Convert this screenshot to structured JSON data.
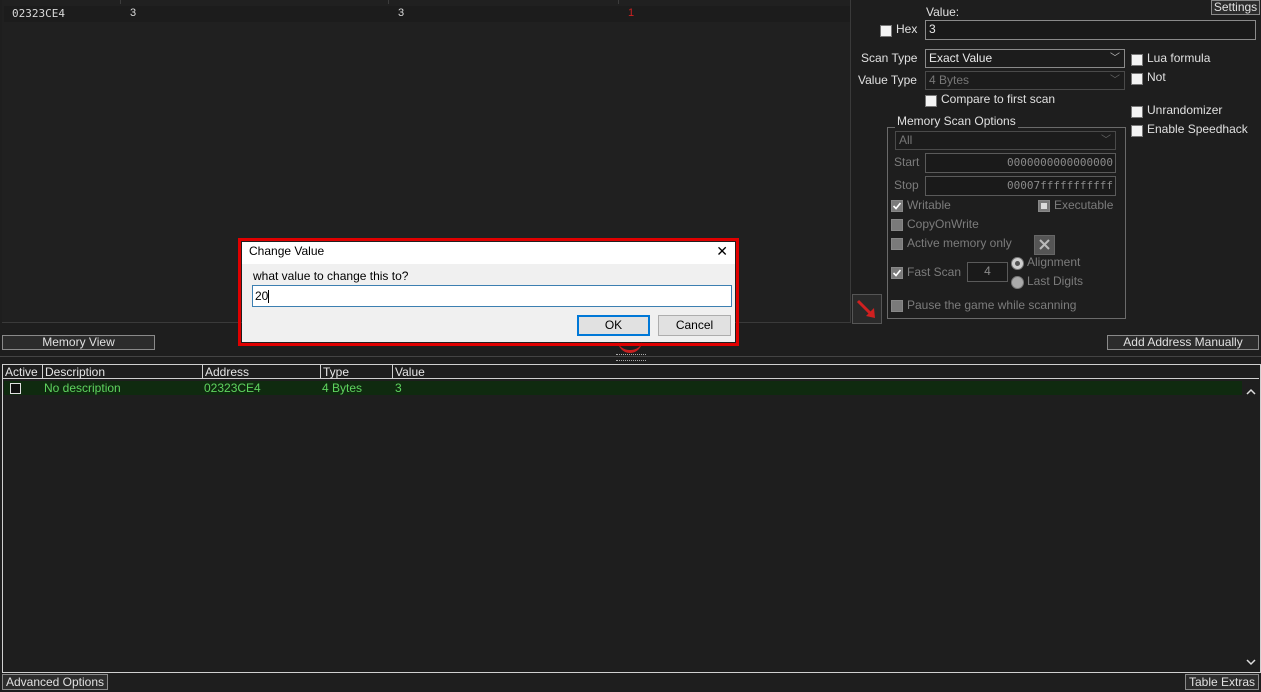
{
  "results": {
    "row": {
      "address": "02323CE4",
      "value": "3",
      "previous": "3",
      "first": "1"
    }
  },
  "scan": {
    "settings_label": "Settings",
    "value_label": "Value:",
    "hex_label": "Hex",
    "value_input": "3",
    "scan_type_label": "Scan Type",
    "scan_type_value": "Exact Value",
    "value_type_label": "Value Type",
    "value_type_value": "4 Bytes",
    "lua_formula_label": "Lua formula",
    "not_label": "Not",
    "compare_first_label": "Compare to first scan",
    "unrandomizer_label": "Unrandomizer",
    "speedhack_label": "Enable Speedhack"
  },
  "memory_options": {
    "title": "Memory Scan Options",
    "region_value": "All",
    "start_label": "Start",
    "start_value": "0000000000000000",
    "stop_label": "Stop",
    "stop_value": "00007fffffffffff",
    "writable_label": "Writable",
    "executable_label": "Executable",
    "copyonwrite_label": "CopyOnWrite",
    "active_memory_label": "Active memory only",
    "fast_scan_label": "Fast Scan",
    "fast_scan_value": "4",
    "alignment_label": "Alignment",
    "last_digits_label": "Last Digits",
    "pause_label": "Pause the game while scanning"
  },
  "toolbar": {
    "memory_view_label": "Memory View",
    "add_address_label": "Add Address Manually"
  },
  "address_table": {
    "headers": [
      "Active",
      "Description",
      "Address",
      "Type",
      "Value"
    ],
    "rows": [
      {
        "description": "No description",
        "address": "02323CE4",
        "type": "4 Bytes",
        "value": "3"
      }
    ]
  },
  "footer": {
    "advanced_label": "Advanced Options",
    "extras_label": "Table Extras"
  },
  "dialog": {
    "title": "Change Value",
    "close_glyph": "✕",
    "prompt": "what value to change this to?",
    "input_value": "20",
    "ok_label": "OK",
    "cancel_label": "Cancel"
  },
  "icons": {
    "arrow": "red-arrow-icon"
  },
  "colors": {
    "highlight_outline": "#e00000",
    "row_text": "#5fd35f",
    "first_value_text": "#cc2222"
  }
}
